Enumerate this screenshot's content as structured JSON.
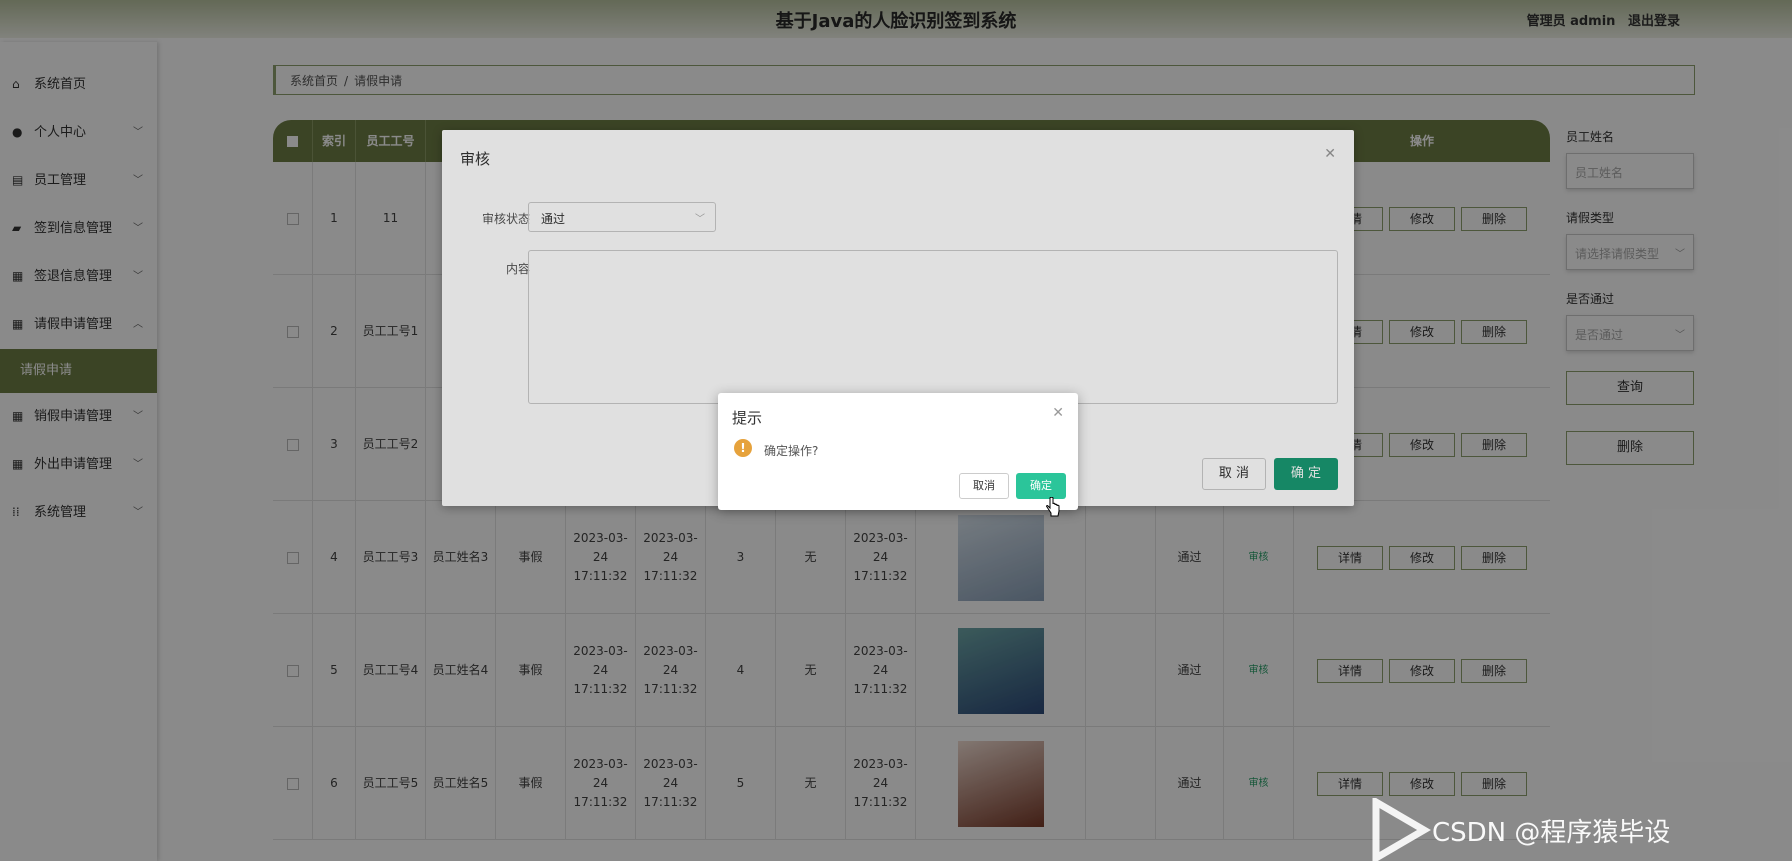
{
  "header": {
    "title": "基于Java的人脸识别签到系统",
    "role_label": "管理员 admin",
    "logout_label": "退出登录"
  },
  "sidebar": {
    "items": [
      {
        "label": "系统首页",
        "icon": "home-icon",
        "expandable": false
      },
      {
        "label": "个人中心",
        "icon": "user-icon",
        "expandable": true
      },
      {
        "label": "员工管理",
        "icon": "clipboard-icon",
        "expandable": true
      },
      {
        "label": "签到信息管理",
        "icon": "briefcase-icon",
        "expandable": true
      },
      {
        "label": "签退信息管理",
        "icon": "grid-icon",
        "expandable": true
      },
      {
        "label": "请假申请管理",
        "icon": "grid-icon",
        "expandable": true,
        "expanded": true
      },
      {
        "label": "销假申请管理",
        "icon": "grid-icon",
        "expandable": true
      },
      {
        "label": "外出申请管理",
        "icon": "grid-icon",
        "expandable": true
      },
      {
        "label": "系统管理",
        "icon": "apps-icon",
        "expandable": true
      }
    ],
    "active_sub": "请假申请"
  },
  "breadcrumb": {
    "home": "系统首页",
    "sep": "/",
    "current": "请假申请"
  },
  "table": {
    "headers": [
      "索引",
      "员工工号",
      "操作"
    ],
    "rows": [
      {
        "index": "1",
        "emp_no": "11",
        "name": "",
        "type": "",
        "start": "",
        "end": "",
        "days": "",
        "reason": "",
        "apply_time": "",
        "status": "",
        "review": ""
      },
      {
        "index": "2",
        "emp_no": "员工工号1",
        "name": "",
        "type": "",
        "start": "",
        "end": "",
        "days": "",
        "reason": "",
        "apply_time": "",
        "status": "",
        "review": ""
      },
      {
        "index": "3",
        "emp_no": "员工工号2",
        "name": "",
        "type": "",
        "start": "",
        "end": "",
        "days": "",
        "reason": "",
        "apply_time": "",
        "status": "",
        "review": ""
      },
      {
        "index": "4",
        "emp_no": "员工工号3",
        "name": "员工姓名3",
        "type": "事假",
        "start": "2023-03-24 17:11:32",
        "end": "2023-03-24 17:11:32",
        "days": "3",
        "reason": "无",
        "apply_time": "2023-03-24 17:11:32",
        "status": "通过",
        "review": "审核"
      },
      {
        "index": "5",
        "emp_no": "员工工号4",
        "name": "员工姓名4",
        "type": "事假",
        "start": "2023-03-24 17:11:32",
        "end": "2023-03-24 17:11:32",
        "days": "4",
        "reason": "无",
        "apply_time": "2023-03-24 17:11:32",
        "status": "通过",
        "review": "审核"
      },
      {
        "index": "6",
        "emp_no": "员工工号5",
        "name": "员工姓名5",
        "type": "事假",
        "start": "2023-03-24 17:11:32",
        "end": "2023-03-24 17:11:32",
        "days": "5",
        "reason": "无",
        "apply_time": "2023-03-24 17:11:32",
        "status": "通过",
        "review": "审核"
      }
    ],
    "op_labels": {
      "detail": "详情",
      "edit": "修改",
      "delete": "删除"
    }
  },
  "filter": {
    "name_label": "员工姓名",
    "name_placeholder": "员工姓名",
    "type_label": "请假类型",
    "type_placeholder": "请选择请假类型",
    "pass_label": "是否通过",
    "pass_placeholder": "是否通过",
    "search_label": "查询",
    "delete_label": "删除"
  },
  "review_dialog": {
    "title": "审核",
    "status_label": "审核状态",
    "status_value": "通过",
    "content_label": "内容",
    "cancel_label": "取 消",
    "confirm_label": "确 定"
  },
  "tip_dialog": {
    "title": "提示",
    "message": "确定操作?",
    "cancel_label": "取消",
    "confirm_label": "确定"
  },
  "watermark": {
    "text": "CSDN @程序猿毕设"
  },
  "colors": {
    "primary": "#6f7f46",
    "accent_green": "#1a9a73",
    "ok_button": "#2bc59a",
    "warning": "#e6a23c"
  }
}
